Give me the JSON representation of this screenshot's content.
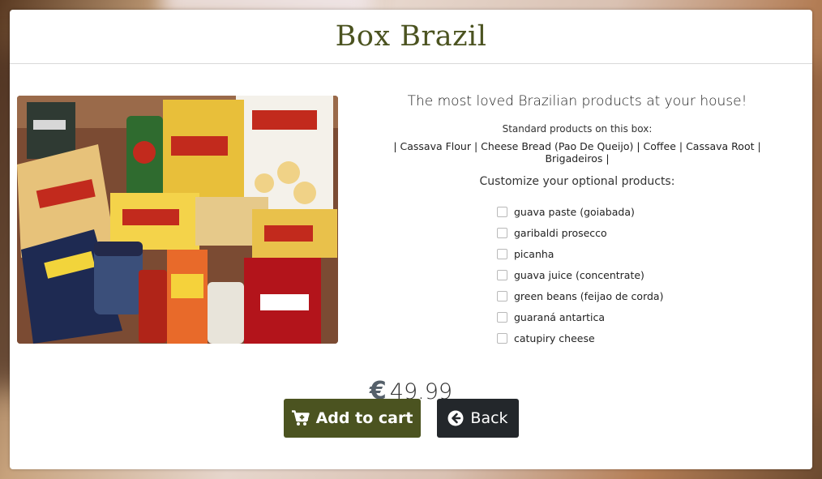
{
  "product": {
    "title": "Box Brazil",
    "image_alt": "Box of Brazilian food products",
    "tagline": "The most loved Brazilian products at your house!",
    "standard_label": "Standard products on this box:",
    "standard_list": "| Cassava Flour | Cheese Bread (Pao De Queijo) | Coffee | Cassava Root | Brigadeiros |",
    "customize_label": "Customize your optional products:",
    "options": [
      {
        "label": "guava paste (goiabada)",
        "checked": false
      },
      {
        "label": "garibaldi prosecco",
        "checked": false
      },
      {
        "label": "picanha",
        "checked": false
      },
      {
        "label": "guava juice (concentrate)",
        "checked": false
      },
      {
        "label": "green beans (feijao de corda)",
        "checked": false
      },
      {
        "label": "guaraná antartica",
        "checked": false
      },
      {
        "label": "catupiry cheese",
        "checked": false
      }
    ],
    "currency_symbol": "€",
    "price": "49.99"
  },
  "buttons": {
    "add_to_cart": "Add to cart",
    "back": "Back"
  },
  "icons": {
    "cart": "shopping-cart-plus-icon",
    "back": "arrow-circle-left-icon"
  },
  "colors": {
    "accent": "#4b5320",
    "dark_button": "#23272b"
  }
}
